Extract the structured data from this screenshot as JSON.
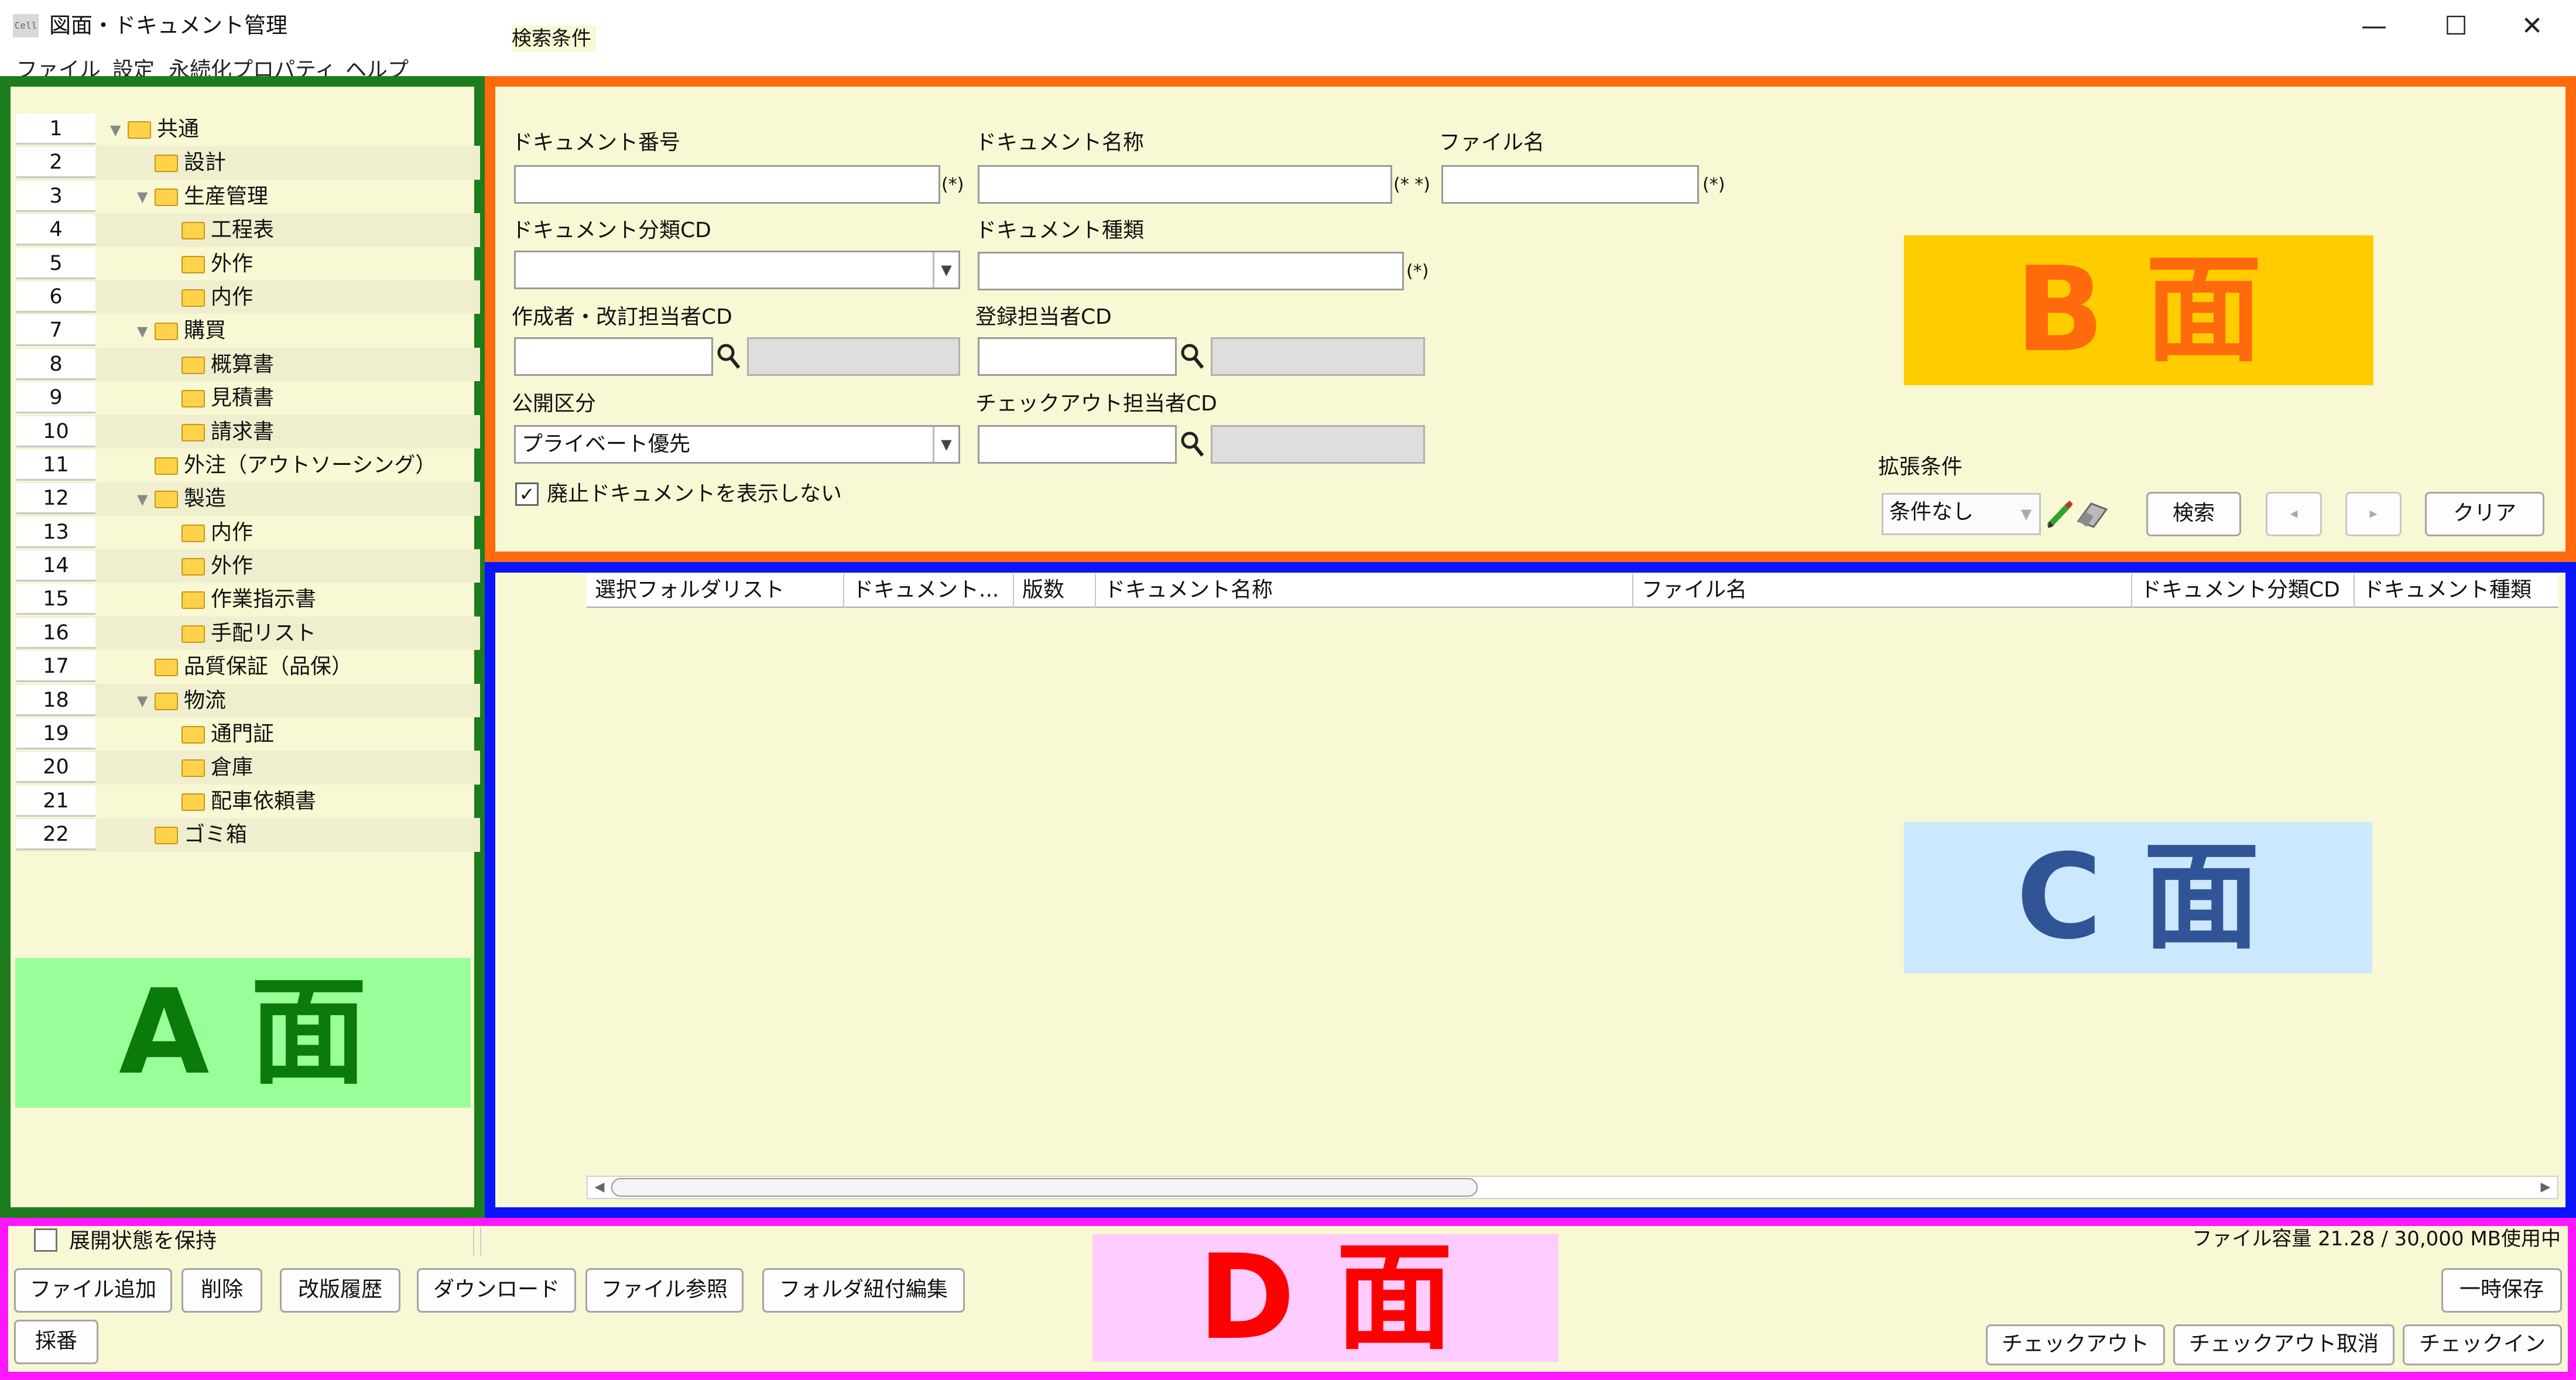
{
  "window": {
    "icon_text": "Cell",
    "title": "図面・ドキュメント管理",
    "minimize": "—",
    "maximize": "☐",
    "close": "✕"
  },
  "menu": [
    "ファイル",
    "設定",
    "永続化プロパティ",
    "ヘルプ"
  ],
  "tree": [
    {
      "num": "1",
      "label": "共通",
      "depth": 0,
      "expanded": true
    },
    {
      "num": "2",
      "label": "設計",
      "depth": 1
    },
    {
      "num": "3",
      "label": "生産管理",
      "depth": 1,
      "expanded": true
    },
    {
      "num": "4",
      "label": "工程表",
      "depth": 2
    },
    {
      "num": "5",
      "label": "外作",
      "depth": 2
    },
    {
      "num": "6",
      "label": "内作",
      "depth": 2
    },
    {
      "num": "7",
      "label": "購買",
      "depth": 1,
      "expanded": true
    },
    {
      "num": "8",
      "label": "概算書",
      "depth": 2
    },
    {
      "num": "9",
      "label": "見積書",
      "depth": 2
    },
    {
      "num": "10",
      "label": "請求書",
      "depth": 2
    },
    {
      "num": "11",
      "label": "外注（アウトソーシング）",
      "depth": 1
    },
    {
      "num": "12",
      "label": "製造",
      "depth": 1,
      "expanded": true
    },
    {
      "num": "13",
      "label": "内作",
      "depth": 2
    },
    {
      "num": "14",
      "label": "外作",
      "depth": 2
    },
    {
      "num": "15",
      "label": "作業指示書",
      "depth": 2
    },
    {
      "num": "16",
      "label": "手配リスト",
      "depth": 2
    },
    {
      "num": "17",
      "label": "品質保証（品保）",
      "depth": 1
    },
    {
      "num": "18",
      "label": "物流",
      "depth": 1,
      "expanded": true
    },
    {
      "num": "19",
      "label": "通門証",
      "depth": 2
    },
    {
      "num": "20",
      "label": "倉庫",
      "depth": 2
    },
    {
      "num": "21",
      "label": "配車依頼書",
      "depth": 2
    },
    {
      "num": "22",
      "label": "ゴミ箱",
      "depth": 1
    }
  ],
  "faces": {
    "a": "A 面",
    "b": "B 面",
    "c": "C 面",
    "d": "D 面"
  },
  "search": {
    "legend": "検索条件",
    "doc_number_label": "ドキュメント番号",
    "doc_number_value": "",
    "doc_number_hint": "(*)",
    "doc_name_label": "ドキュメント名称",
    "doc_name_value": "",
    "doc_name_hint": "(* *)",
    "file_name_label": "ファイル名",
    "file_name_value": "",
    "file_name_hint": "(*)",
    "doc_class_label": "ドキュメント分類CD",
    "doc_class_value": "",
    "doc_type_label": "ドキュメント種類",
    "doc_type_value": "",
    "doc_type_hint": "(*)",
    "author_label": "作成者・改訂担当者CD",
    "author_value": "",
    "registrant_label": "登録担当者CD",
    "registrant_value": "",
    "visibility_label": "公開区分",
    "visibility_value": "プライベート優先",
    "checkout_label": "チェックアウト担当者CD",
    "checkout_value": "",
    "hide_obsolete_label": "廃止ドキュメントを表示しない",
    "hide_obsolete_checked": true,
    "ext_label": "拡張条件",
    "ext_value": "条件なし",
    "search_button": "検索",
    "prev_button": "◂",
    "next_button": "▸",
    "clear_button": "クリア"
  },
  "grid": {
    "columns": [
      "選択フォルダリスト",
      "ドキュメント...",
      "版数",
      "ドキュメント名称",
      "ファイル名",
      "ドキュメント分類CD",
      "ドキュメント種類"
    ]
  },
  "bottom": {
    "keep_expand_label": "展開状態を保持",
    "keep_expand_checked": false,
    "file_capacity": "ファイル容量 21.28 / 30,000 MB使用中",
    "buttons_row1": [
      "ファイル追加",
      "削除",
      "改版履歴",
      "ダウンロード",
      "ファイル参照",
      "フォルダ紐付編集"
    ],
    "numbering_button": "採番",
    "temp_save_button": "一時保存",
    "checkout_button": "チェックアウト",
    "checkout_cancel_button": "チェックアウト取消",
    "checkin_button": "チェックイン"
  },
  "colors": {
    "panel_bg": "#f8f8d4",
    "border_a": "#1d7d1d",
    "border_b": "#ff6a0d",
    "border_c": "#0a14ff",
    "border_d": "#ff17ff",
    "face_a_bg": "#99ff99",
    "face_a_text": "#0a7a0a",
    "face_b_bg": "#ffcc00",
    "face_b_text": "#ff6a0d",
    "face_c_bg": "#cce8ff",
    "face_c_text": "#2f5596",
    "face_d_bg": "#ffccff",
    "face_d_text": "#ff0000"
  }
}
